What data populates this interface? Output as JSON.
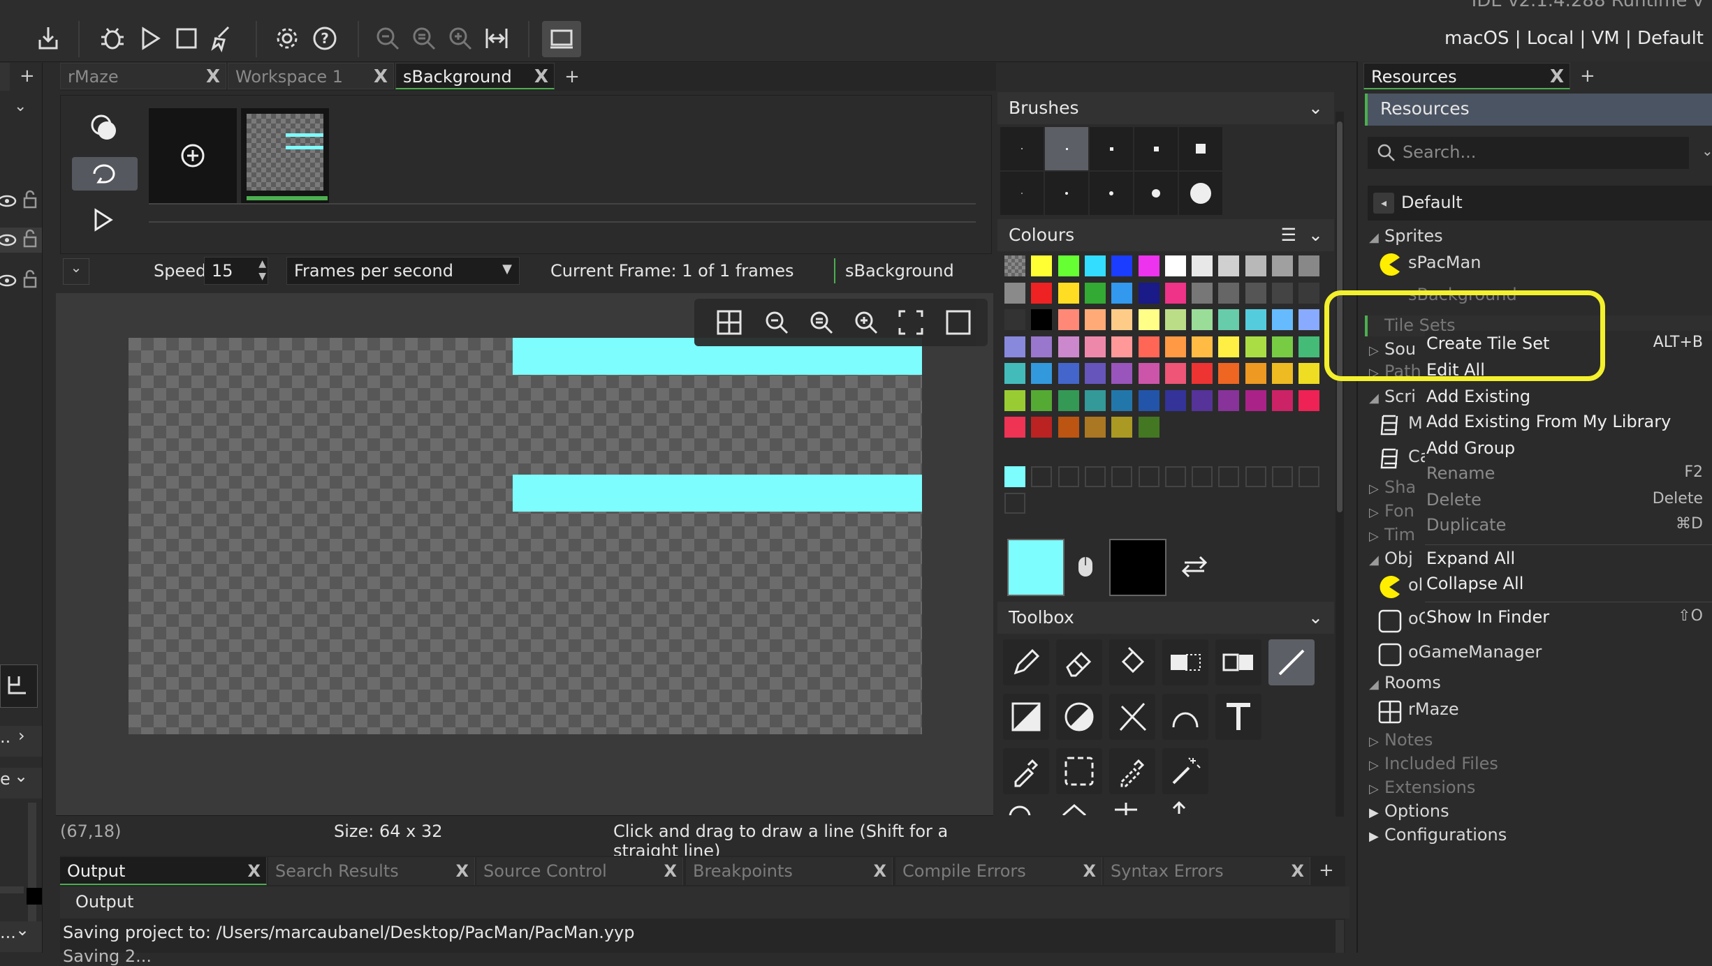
{
  "window": {
    "title": "IDE v2.1.4.288 Runtime v",
    "target": "macOS | Local | VM | Default"
  },
  "toolbar": {
    "icons": [
      "create-executable-icon",
      "debug-icon",
      "run-icon",
      "stop-icon",
      "clean-icon",
      "preferences-icon",
      "help-icon",
      "zoom-reset-icon",
      "zoom-out-icon",
      "zoom-in-icon",
      "fit-icon",
      "device-icon"
    ]
  },
  "left_tabs": [
    {
      "label": "rMaze",
      "active": false
    },
    {
      "label": "Workspace 1",
      "active": false
    },
    {
      "label": "sBackground",
      "active": true
    }
  ],
  "sprite_editor": {
    "speed_label": "Speed:",
    "speed_value": "15",
    "speed_unit": "Frames per second",
    "current_frame": "Current Frame: 1 of 1 frames",
    "sprite_name": "sBackground",
    "coords": "(67,18)",
    "size": "Size: 64 x 32",
    "hint": "Click and drag to draw a line (Shift for a straight line)"
  },
  "brushes": {
    "title": "Brushes"
  },
  "colours": {
    "title": "Colours",
    "primary": "#7dfdfe",
    "secondary": "#000000",
    "palette": [
      [
        "checker",
        "#ffff33",
        "#66ff33",
        "#33ddff",
        "#1a3dff",
        "#ee33ee",
        "#ffffff",
        "#e8e8e8",
        "#d0d0d0",
        "#b8b8b8",
        "#a0a0a0",
        "#888888"
      ],
      [
        "#8a8a8a",
        "#ee2222",
        "#ffdd22",
        "#33aa33",
        "#3399ee",
        "#1a1a88",
        "#ee3388",
        "#777777",
        "#666666",
        "#555555",
        "#444444",
        "#3a3a3a"
      ],
      [
        "#333333",
        "#000000",
        "#ff8877",
        "#ffaa77",
        "#ffcc88",
        "#ffff88",
        "#bbdd88",
        "#99dd99",
        "#66ccaa",
        "#55ccdd",
        "#66bbff",
        "#88aaff"
      ],
      [
        "#8888dd",
        "#9977cc",
        "#cc88cc",
        "#ee88aa",
        "#ff9999",
        "#ff6655",
        "#ff9944",
        "#ffbb44",
        "#ffee44",
        "#aadd44",
        "#77cc44",
        "#44bb77"
      ],
      [
        "#44bbbb",
        "#3399dd",
        "#4466cc",
        "#6655bb",
        "#9955bb",
        "#cc55aa",
        "#ee5577",
        "#ee3333",
        "#ee6622",
        "#ee9922",
        "#eebb22",
        "#eedd22"
      ],
      [
        "#99cc33",
        "#55aa33",
        "#339955",
        "#339999",
        "#2277aa",
        "#2255aa",
        "#333399",
        "#553399",
        "#883399",
        "#aa2288",
        "#cc2266",
        "#ee2255"
      ],
      [
        "#ee3355",
        "#bb2222",
        "#bb5511",
        "#aa7722",
        "#aa9922",
        "#447722"
      ]
    ]
  },
  "toolbox": {
    "title": "Toolbox"
  },
  "resources": {
    "tab": "Resources",
    "header": "Resources",
    "search_placeholder": "Search...",
    "default_label": "Default",
    "tree": [
      {
        "label": "Sprites",
        "level": 0,
        "arrow": "◢"
      },
      {
        "label": "sPacMan",
        "level": 1
      },
      {
        "label": "sBackground",
        "level": 1
      },
      {
        "label": "Tile Sets",
        "level": 0
      },
      {
        "label": "Sou",
        "level": 0
      },
      {
        "label": "Path",
        "level": 0
      },
      {
        "label": "Scri",
        "level": 0
      },
      {
        "label": "M",
        "level": 1
      },
      {
        "label": "Ca",
        "level": 1
      },
      {
        "label": "Sha",
        "level": 0
      },
      {
        "label": "Fon",
        "level": 0
      },
      {
        "label": "Tim",
        "level": 0
      },
      {
        "label": "Obj",
        "level": 0
      },
      {
        "label": "ol",
        "level": 1
      },
      {
        "label": "oG",
        "level": 1
      },
      {
        "label": "oGameManager",
        "level": 1
      },
      {
        "label": "Rooms",
        "level": 0
      },
      {
        "label": "rMaze",
        "level": 1
      },
      {
        "label": "Notes",
        "level": 0
      },
      {
        "label": "Included Files",
        "level": 0
      },
      {
        "label": "Extensions",
        "level": 0
      },
      {
        "label": "Options",
        "level": 0
      },
      {
        "label": "Configurations",
        "level": 0
      }
    ]
  },
  "context_menu": [
    {
      "label": "Create Tile Set",
      "key": "ALT+B",
      "dim": false
    },
    {
      "label": "Edit All",
      "key": "",
      "dim": false
    },
    {
      "label": "Add Existing",
      "key": "",
      "dim": false
    },
    {
      "label": "Add Existing From My Library",
      "key": "",
      "dim": false
    },
    {
      "label": "Add Group",
      "key": "",
      "dim": false
    },
    {
      "label": "Rename",
      "key": "F2",
      "dim": true
    },
    {
      "label": "Delete",
      "key": "Delete",
      "dim": true
    },
    {
      "label": "Duplicate",
      "key": "⌘D",
      "dim": true
    },
    {
      "label": "Expand All",
      "key": "",
      "dim": false
    },
    {
      "label": "Collapse All",
      "key": "",
      "dim": false
    },
    {
      "label": "Show In Finder",
      "key": "⇧O",
      "dim": false
    }
  ],
  "output": {
    "tabs": [
      "Output",
      "Search Results",
      "Source Control",
      "Breakpoints",
      "Compile Errors",
      "Syntax Errors"
    ],
    "header": "Output",
    "line1": "Saving project to: /Users/marcaubanel/Desktop/PacMan/PacMan.yyp",
    "line2": "Saving 2..."
  },
  "left_strip": {
    "item1": "..",
    "item2": "e",
    "item3": "..."
  },
  "colors": {
    "accent_green": "#4caf50",
    "highlight_yellow": "#f3f02c",
    "cyan": "#7dfdfe"
  }
}
